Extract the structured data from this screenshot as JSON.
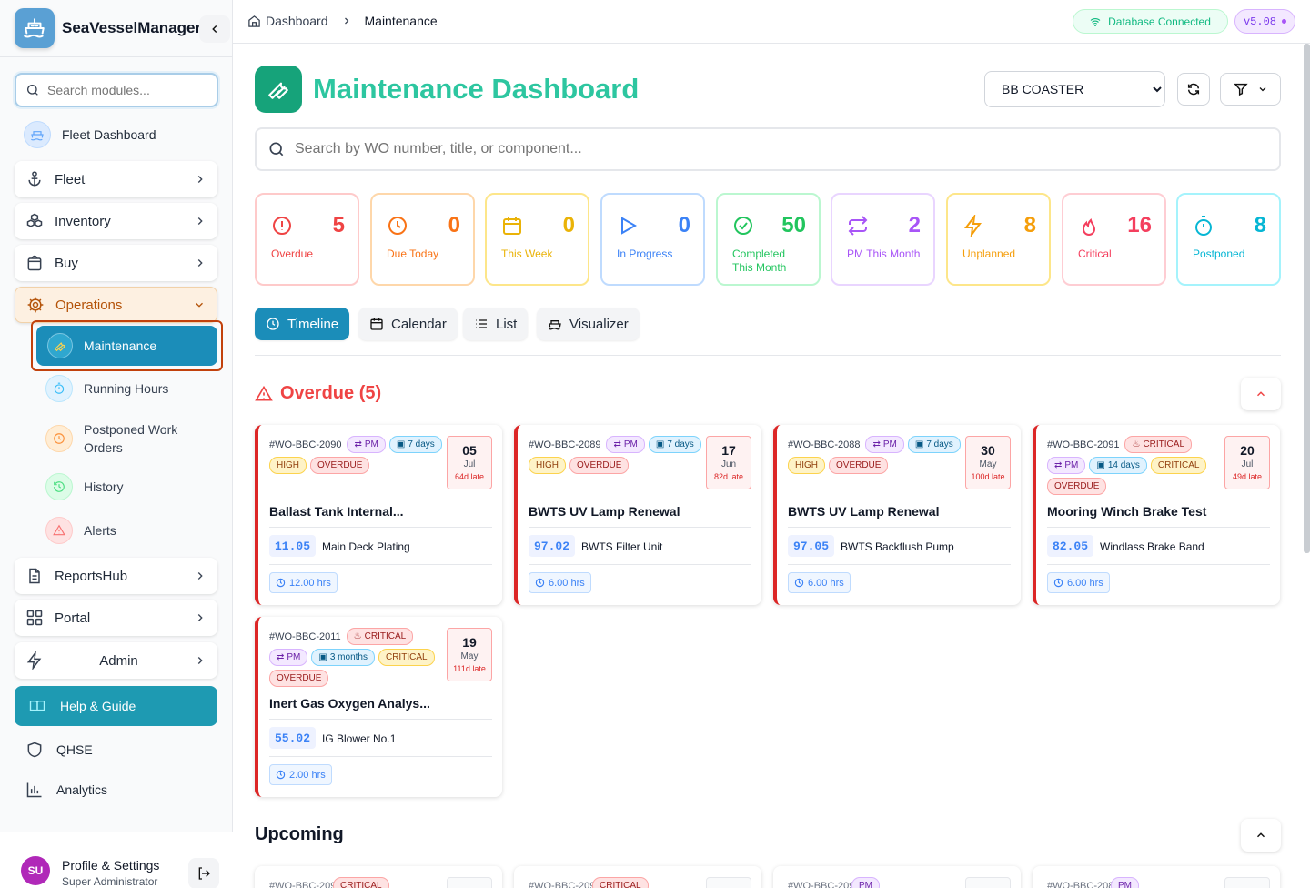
{
  "app": {
    "name": "SeaVesselManager",
    "version": "v5.08",
    "db_status": "Database Connected"
  },
  "sidebar": {
    "search_placeholder": "Search modules...",
    "fleet_dashboard": "Fleet Dashboard",
    "groups": [
      {
        "label": "Fleet"
      },
      {
        "label": "Inventory"
      },
      {
        "label": "Buy"
      },
      {
        "label": "Operations"
      }
    ],
    "operations_items": [
      {
        "label": "Maintenance",
        "active": true
      },
      {
        "label": "Running Hours"
      },
      {
        "label": "Postponed Work Orders"
      },
      {
        "label": "History"
      },
      {
        "label": "Alerts"
      }
    ],
    "more_groups": [
      {
        "label": "ReportsHub"
      },
      {
        "label": "Portal"
      },
      {
        "label": "Admin"
      }
    ],
    "help": "Help & Guide",
    "qhse": "QHSE",
    "analytics": "Analytics",
    "profile": {
      "initials": "SU",
      "name": "Profile & Settings",
      "role": "Super Administrator"
    }
  },
  "breadcrumb": {
    "home": "Dashboard",
    "current": "Maintenance"
  },
  "page": {
    "title": "Maintenance Dashboard",
    "vessel_selected": "BB COASTER",
    "search_placeholder": "Search by WO number, title, or component..."
  },
  "stats": [
    {
      "value": "5",
      "label": "Overdue",
      "color": "#ef4444",
      "bg_border": "#fecaca",
      "icon": "alert-circle-icon"
    },
    {
      "value": "0",
      "label": "Due Today",
      "color": "#f97316",
      "bg_border": "#fed7aa",
      "icon": "clock-icon"
    },
    {
      "value": "0",
      "label": "This Week",
      "color": "#eab308",
      "bg_border": "#fde68a",
      "icon": "calendar-icon"
    },
    {
      "value": "0",
      "label": "In Progress",
      "color": "#3b82f6",
      "bg_border": "#bfdbfe",
      "icon": "play-icon"
    },
    {
      "value": "50",
      "label": "Completed This Month",
      "color": "#22c55e",
      "bg_border": "#bbf7d0",
      "icon": "check-circle-icon"
    },
    {
      "value": "2",
      "label": "PM This Month",
      "color": "#a855f7",
      "bg_border": "#e9d5ff",
      "icon": "repeat-icon"
    },
    {
      "value": "8",
      "label": "Unplanned",
      "color": "#f59e0b",
      "bg_border": "#fde68a",
      "icon": "zap-icon"
    },
    {
      "value": "16",
      "label": "Critical",
      "color": "#f43f5e",
      "bg_border": "#fecdd3",
      "icon": "flame-icon"
    },
    {
      "value": "8",
      "label": "Postponed",
      "color": "#06b6d4",
      "bg_border": "#a5f3fc",
      "icon": "timer-icon"
    }
  ],
  "tabs": [
    {
      "label": "Timeline",
      "active": true
    },
    {
      "label": "Calendar"
    },
    {
      "label": "List"
    },
    {
      "label": "Visualizer"
    }
  ],
  "overdue": {
    "title": "Overdue (5)",
    "items": [
      {
        "wo": "#WO-BBC-2090",
        "tags": [
          "PM",
          "7 days",
          "HIGH",
          "OVERDUE"
        ],
        "day": "05",
        "month": "Jul",
        "late": "64d late",
        "title": "Ballast Tank Internal...",
        "code": "11.05",
        "component": "Main Deck Plating",
        "hours": "12.00 hrs"
      },
      {
        "wo": "#WO-BBC-2089",
        "tags": [
          "PM",
          "7 days",
          "HIGH",
          "OVERDUE"
        ],
        "day": "17",
        "month": "Jun",
        "late": "82d late",
        "title": "BWTS UV Lamp Renewal",
        "code": "97.02",
        "component": "BWTS Filter Unit",
        "hours": "6.00 hrs"
      },
      {
        "wo": "#WO-BBC-2088",
        "tags": [
          "PM",
          "7 days",
          "HIGH",
          "OVERDUE"
        ],
        "day": "30",
        "month": "May",
        "late": "100d late",
        "title": "BWTS UV Lamp Renewal",
        "code": "97.05",
        "component": "BWTS Backflush Pump",
        "hours": "6.00 hrs"
      },
      {
        "wo": "#WO-BBC-2091",
        "tags": [
          "CRITICAL",
          "PM",
          "14 days",
          "CRITICAL",
          "OVERDUE"
        ],
        "day": "20",
        "month": "Jul",
        "late": "49d late",
        "title": "Mooring Winch Brake Test",
        "code": "82.05",
        "component": "Windlass Brake Band",
        "hours": "6.00 hrs"
      },
      {
        "wo": "#WO-BBC-2011",
        "tags": [
          "CRITICAL",
          "PM",
          "3 months",
          "CRITICAL",
          "OVERDUE"
        ],
        "day": "19",
        "month": "May",
        "late": "111d late",
        "title": "Inert Gas Oxygen Analys...",
        "code": "55.02",
        "component": "IG Blower No.1",
        "hours": "2.00 hrs"
      }
    ]
  },
  "upcoming": {
    "title": "Upcoming",
    "items": [
      {
        "wo": "#WO-BBC-2094",
        "tag": "CRITICAL"
      },
      {
        "wo": "#WO-BBC-2093",
        "tag": "CRITICAL"
      },
      {
        "wo": "#WO-BBC-2092",
        "tag": "PM"
      },
      {
        "wo": "#WO-BBC-2081",
        "tag": "PM"
      }
    ]
  },
  "colors": {
    "accent": "#1b8db9",
    "title": "#2dc6a0",
    "overdue": "#ef4444"
  }
}
